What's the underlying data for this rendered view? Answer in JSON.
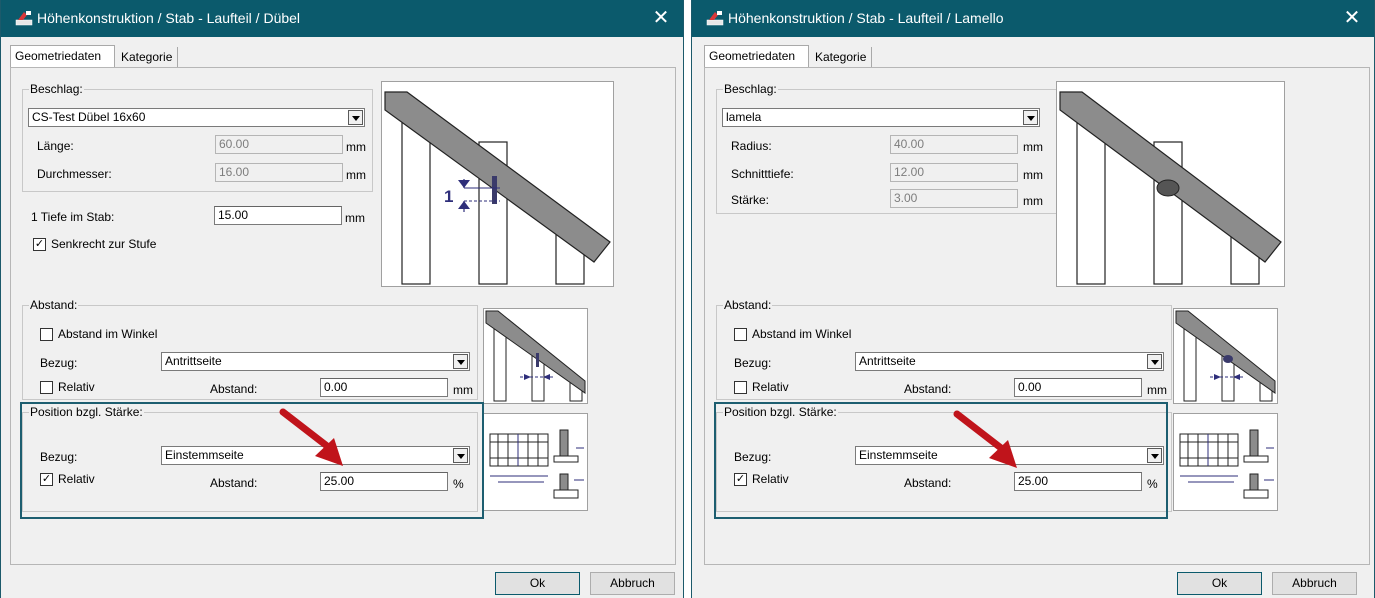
{
  "left_dialog": {
    "title": "Höhenkonstruktion / Stab - Laufteil / Dübel",
    "close_glyph": "✕",
    "tabs": [
      {
        "label": "Geometriedaten"
      },
      {
        "label": "Kategorie"
      }
    ],
    "beschlag": {
      "group_label": "Beschlag:",
      "selected": "CS-Test Dübel 16x60",
      "rows": [
        {
          "label": "Länge:",
          "value": "60.00",
          "unit": "mm"
        },
        {
          "label": "Durchmesser:",
          "value": "16.00",
          "unit": "mm"
        }
      ]
    },
    "tiefe": {
      "label": "1 Tiefe im Stab:",
      "value": "15.00",
      "unit": "mm"
    },
    "senkrecht": {
      "label": "Senkrecht zur Stufe",
      "checked": true
    },
    "diagram_label": "1",
    "abstand": {
      "group_label": "Abstand:",
      "winkel_label": "Abstand im Winkel",
      "bezug_label": "Bezug:",
      "bezug_value": "Antrittseite",
      "relativ_label": "Relativ",
      "abstand_label": "Abstand:",
      "abstand_value": "0.00",
      "unit": "mm"
    },
    "position": {
      "group_label": "Position bzgl. Stärke:",
      "bezug_label": "Bezug:",
      "bezug_value": "Einstemmseite",
      "relativ_label": "Relativ",
      "abstand_label": "Abstand:",
      "abstand_value": "25.00",
      "unit": "%"
    },
    "ok_label": "Ok",
    "cancel_label": "Abbruch"
  },
  "right_dialog": {
    "title": "Höhenkonstruktion / Stab - Laufteil / Lamello",
    "close_glyph": "✕",
    "tabs": [
      {
        "label": "Geometriedaten"
      },
      {
        "label": "Kategorie"
      }
    ],
    "beschlag": {
      "group_label": "Beschlag:",
      "selected": "lamela",
      "rows": [
        {
          "label": "Radius:",
          "value": "40.00",
          "unit": "mm"
        },
        {
          "label": "Schnitttiefe:",
          "value": "12.00",
          "unit": "mm"
        },
        {
          "label": "Stärke:",
          "value": "3.00",
          "unit": "mm"
        }
      ]
    },
    "abstand": {
      "group_label": "Abstand:",
      "winkel_label": "Abstand im Winkel",
      "bezug_label": "Bezug:",
      "bezug_value": "Antrittseite",
      "relativ_label": "Relativ",
      "abstand_label": "Abstand:",
      "abstand_value": "0.00",
      "unit": "mm"
    },
    "position": {
      "group_label": "Position bzgl. Stärke:",
      "bezug_label": "Bezug:",
      "bezug_value": "Einstemmseite",
      "relativ_label": "Relativ",
      "abstand_label": "Abstand:",
      "abstand_value": "25.00",
      "unit": "%"
    },
    "ok_label": "Ok",
    "cancel_label": "Abbruch"
  },
  "colors": {
    "titlebar": "#0b5a6c",
    "highlight_frame": "#1d5e70",
    "annotation_arrow": "#c0141b"
  }
}
